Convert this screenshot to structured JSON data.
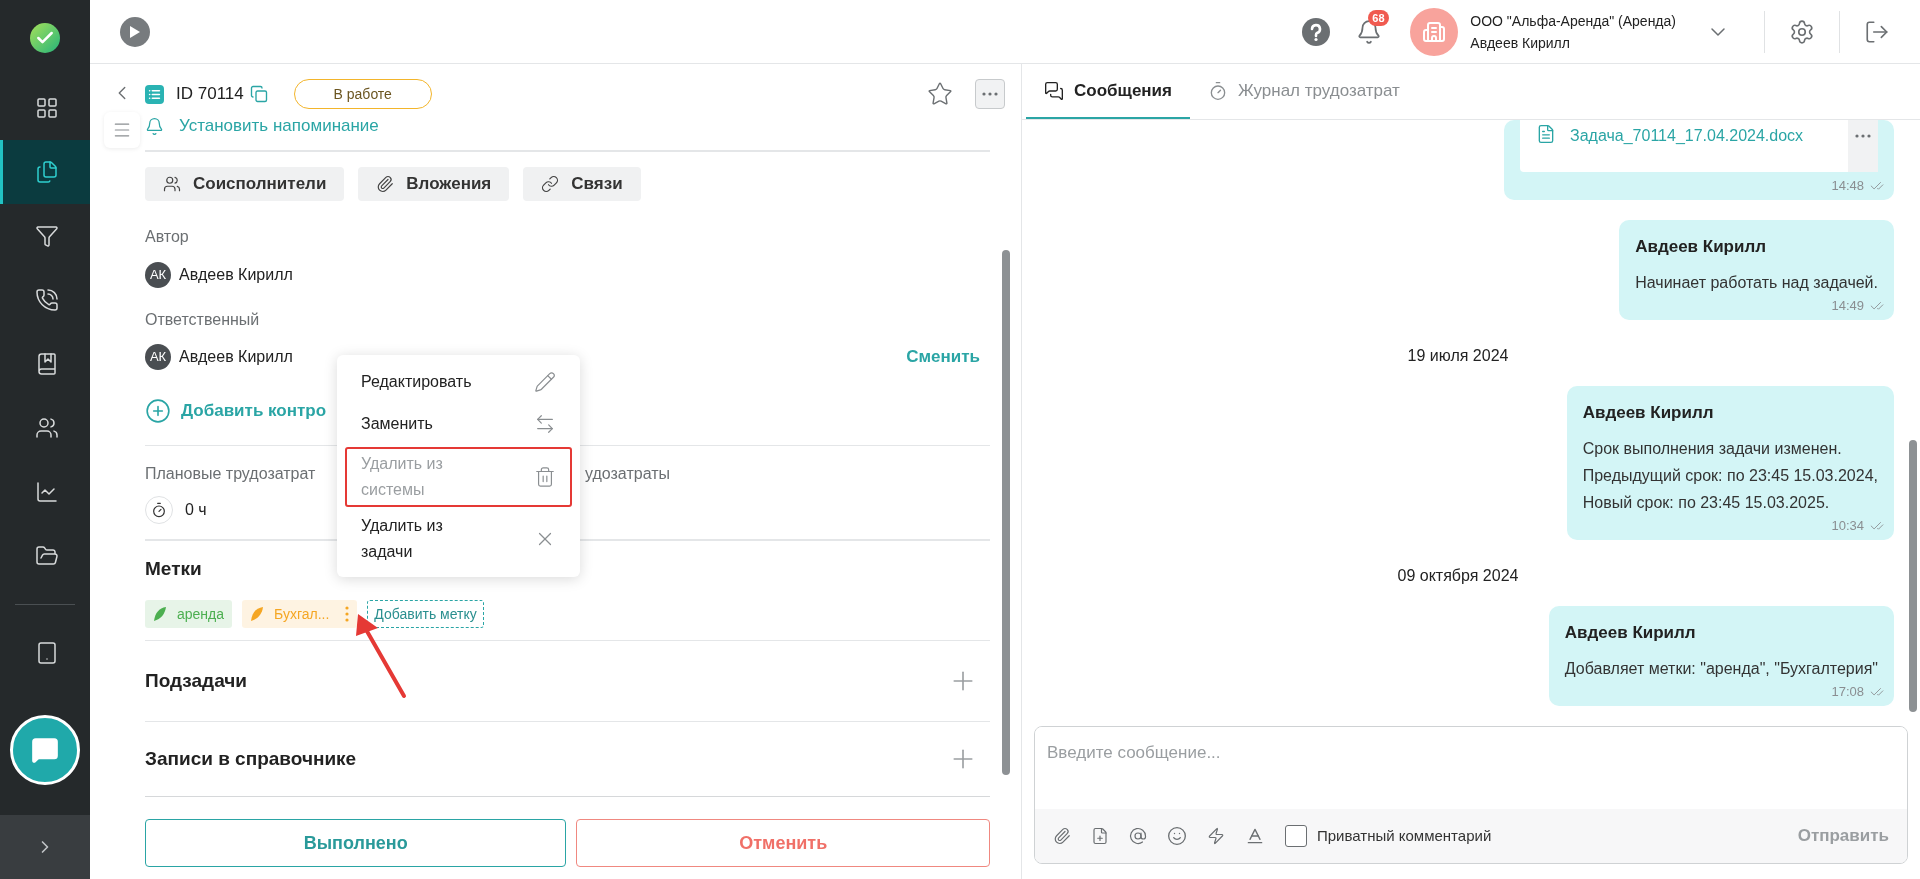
{
  "topbar": {
    "notifications_badge": "68",
    "org": "ООО \"Альфа-Аренда\" (Аренда)",
    "user": "Авдеев Кирилл"
  },
  "sidebar": {
    "items": [
      {
        "selected": false
      },
      {
        "selected": true
      },
      {
        "selected": false
      },
      {
        "selected": false
      },
      {
        "selected": false
      },
      {
        "selected": false
      },
      {
        "selected": false
      },
      {
        "selected": false
      },
      {
        "selected": false
      }
    ]
  },
  "task": {
    "id": "ID 70114",
    "status": "В работе",
    "reminder": "Установить напоминание",
    "actions": [
      "Соисполнители",
      "Вложения",
      "Связи"
    ],
    "author_label": "Автор",
    "author": {
      "initials": "АК",
      "name": "Авдеев Кирилл"
    },
    "responsible_label": "Ответственный",
    "responsible": {
      "initials": "АК",
      "name": "Авдеев Кирилл"
    },
    "change_link": "Сменить",
    "add_controller": "Добавить контро",
    "effort_planned_label": "Плановые трудозатрат",
    "effort_actual_label": "удозатраты",
    "effort_planned_value": "0 ч",
    "tags_title": "Метки",
    "tags": [
      {
        "label": "аренда",
        "color": "#4caf50",
        "menu_open": false
      },
      {
        "label": "Бухгал...",
        "color": "#f5a623",
        "menu_open": true
      }
    ],
    "add_tag": "Добавить метку",
    "sections": [
      "Подзадачи",
      "Записи в справочнике"
    ],
    "done_button": "Выполнено",
    "cancel_button": "Отменить"
  },
  "context_menu": {
    "items": [
      {
        "label": "Редактировать",
        "disabled": false,
        "highlighted": false
      },
      {
        "label": "Заменить",
        "disabled": false,
        "highlighted": false
      },
      {
        "label": "Удалить из системы",
        "disabled": true,
        "highlighted": true
      },
      {
        "label": "Удалить из задачи",
        "disabled": false,
        "highlighted": false
      }
    ]
  },
  "chat": {
    "tabs": [
      {
        "label": "Сообщения",
        "selected": true
      },
      {
        "label": "Журнал трудозатрат",
        "selected": false
      }
    ],
    "feed": [
      {
        "kind": "file",
        "file": "Задача_70114_17.04.2024.docx",
        "time": "14:48"
      },
      {
        "kind": "message",
        "author": "Авдеев Кирилл",
        "lines": [
          "Начинает работать над задачей."
        ],
        "time": "14:49"
      },
      {
        "kind": "date",
        "text": "19 июля 2024"
      },
      {
        "kind": "message",
        "author": "Авдеев Кирилл",
        "lines": [
          "Срок выполнения задачи изменен.",
          "Предыдущий срок: по 23:45 15.03.2024,",
          "Новый срок: по 23:45 15.03.2025."
        ],
        "time": "10:34"
      },
      {
        "kind": "date",
        "text": "09 октября 2024"
      },
      {
        "kind": "message",
        "author": "Авдеев Кирилл",
        "lines": [
          "Добавляет метки: \"аренда\", \"Бухгалтерия\""
        ],
        "time": "17:08"
      }
    ],
    "composer": {
      "placeholder": "Введите сообщение...",
      "private_label": "Приватный комментарий",
      "private_checked": false,
      "send": "Отправить"
    }
  }
}
